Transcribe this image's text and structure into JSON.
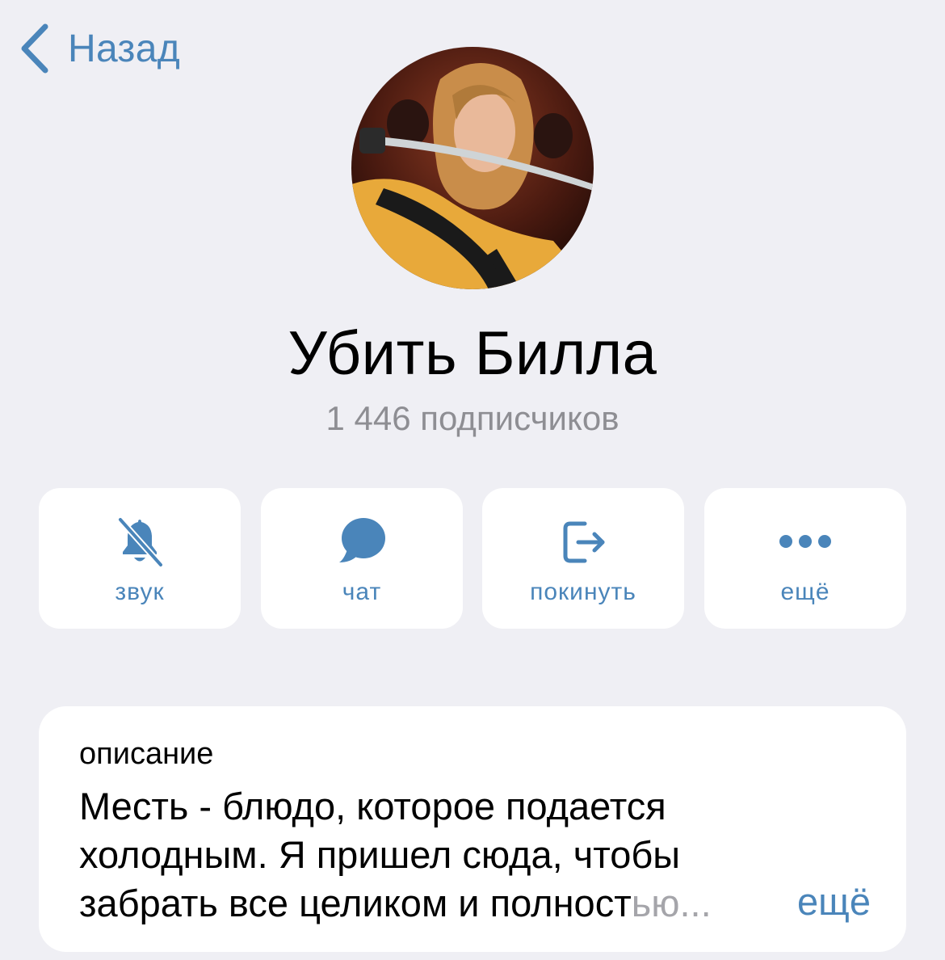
{
  "nav": {
    "back_label": "Назад"
  },
  "channel": {
    "title": "Убить Билла",
    "subscribers": "1 446 подписчиков"
  },
  "actions": [
    {
      "label": "звук",
      "icon": "bell-muted-icon"
    },
    {
      "label": "чат",
      "icon": "chat-bubble-icon"
    },
    {
      "label": "покинуть",
      "icon": "leave-icon"
    },
    {
      "label": "ещё",
      "icon": "more-dots-icon"
    }
  ],
  "description": {
    "heading": "описание",
    "line1": "Месть - блюдо, которое подается",
    "line2": "холодным. Я пришел сюда, чтобы",
    "line3": "забрать все целиком и полност",
    "line3_fade": "ью...",
    "more_label": "ещё"
  },
  "colors": {
    "accent": "#4a85ba",
    "background": "#efeff4",
    "secondary_text": "#8e8e93"
  }
}
